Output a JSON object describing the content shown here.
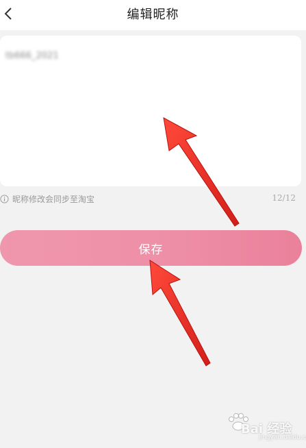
{
  "header": {
    "title": "编辑昵称",
    "back_icon": "chevron-left-icon"
  },
  "nickname": {
    "value": "tb666_2021"
  },
  "hint": {
    "text": "昵称修改会同步至淘宝",
    "icon": "info-icon"
  },
  "counter": {
    "text": "12/12"
  },
  "save_button": {
    "label": "保存",
    "color": "#ee8fa7"
  },
  "annotation": {
    "arrow_color": "#e8332a"
  },
  "watermark": {
    "text": "Bai 经验",
    "sub": "jingyan.baidu.com"
  }
}
